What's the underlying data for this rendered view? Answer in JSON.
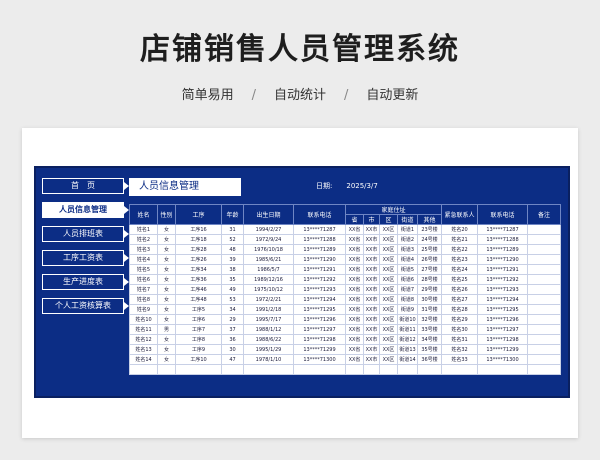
{
  "page": {
    "title": "店铺销售人员管理系统",
    "features": [
      "简单易用",
      "自动统计",
      "自动更新"
    ],
    "separator": "/"
  },
  "sidebar": {
    "items": [
      {
        "label": "首　页",
        "active": false
      },
      {
        "label": "人员信息管理",
        "active": true
      },
      {
        "label": "人员排班表",
        "active": false
      },
      {
        "label": "工序工资表",
        "active": false
      },
      {
        "label": "生产进度表",
        "active": false
      },
      {
        "label": "个人工资核算表",
        "active": false
      }
    ]
  },
  "header": {
    "section_title": "人员信息管理",
    "date_label": "日期:",
    "date_value": "2025/3/7"
  },
  "table": {
    "headers": {
      "name": "姓名",
      "gender": "性别",
      "process": "工序",
      "age": "年龄",
      "birth": "出生日期",
      "phone": "联系电话",
      "address": "家庭住址",
      "province": "省",
      "city": "市",
      "district": "区",
      "street": "街道",
      "other": "其他",
      "emergency_contact": "紧急联系人",
      "emergency_phone": "联系电话",
      "remark": "备注"
    },
    "rows": [
      {
        "name": "姓名1",
        "gender": "女",
        "process": "工序16",
        "age": "31",
        "birth": "1994/2/27",
        "phone": "13****71287",
        "province": "XX省",
        "city": "XX市",
        "district": "XX区",
        "street": "街道1",
        "other": "23号楼",
        "ec": "姓名20",
        "ep": "13****71287",
        "remark": ""
      },
      {
        "name": "姓名2",
        "gender": "女",
        "process": "工序18",
        "age": "52",
        "birth": "1972/9/24",
        "phone": "13****71288",
        "province": "XX省",
        "city": "XX市",
        "district": "XX区",
        "street": "街道2",
        "other": "24号楼",
        "ec": "姓名21",
        "ep": "13****71288",
        "remark": ""
      },
      {
        "name": "姓名3",
        "gender": "女",
        "process": "工序28",
        "age": "48",
        "birth": "1976/10/18",
        "phone": "13****71289",
        "province": "XX省",
        "city": "XX市",
        "district": "XX区",
        "street": "街道3",
        "other": "25号楼",
        "ec": "姓名22",
        "ep": "13****71289",
        "remark": ""
      },
      {
        "name": "姓名4",
        "gender": "女",
        "process": "工序26",
        "age": "39",
        "birth": "1985/6/21",
        "phone": "13****71290",
        "province": "XX省",
        "city": "XX市",
        "district": "XX区",
        "street": "街道4",
        "other": "26号楼",
        "ec": "姓名23",
        "ep": "13****71290",
        "remark": ""
      },
      {
        "name": "姓名5",
        "gender": "女",
        "process": "工序34",
        "age": "38",
        "birth": "1986/5/7",
        "phone": "13****71291",
        "province": "XX省",
        "city": "XX市",
        "district": "XX区",
        "street": "街道5",
        "other": "27号楼",
        "ec": "姓名24",
        "ep": "13****71291",
        "remark": ""
      },
      {
        "name": "姓名6",
        "gender": "女",
        "process": "工序36",
        "age": "35",
        "birth": "1989/12/16",
        "phone": "13****71292",
        "province": "XX省",
        "city": "XX市",
        "district": "XX区",
        "street": "街道6",
        "other": "28号楼",
        "ec": "姓名25",
        "ep": "13****71292",
        "remark": ""
      },
      {
        "name": "姓名7",
        "gender": "女",
        "process": "工序46",
        "age": "49",
        "birth": "1975/10/12",
        "phone": "13****71293",
        "province": "XX省",
        "city": "XX市",
        "district": "XX区",
        "street": "街道7",
        "other": "29号楼",
        "ec": "姓名26",
        "ep": "13****71293",
        "remark": ""
      },
      {
        "name": "姓名8",
        "gender": "女",
        "process": "工序48",
        "age": "53",
        "birth": "1972/2/21",
        "phone": "13****71294",
        "province": "XX省",
        "city": "XX市",
        "district": "XX区",
        "street": "街道8",
        "other": "30号楼",
        "ec": "姓名27",
        "ep": "13****71294",
        "remark": ""
      },
      {
        "name": "姓名9",
        "gender": "女",
        "process": "工序5",
        "age": "34",
        "birth": "1991/2/18",
        "phone": "13****71295",
        "province": "XX省",
        "city": "XX市",
        "district": "XX区",
        "street": "街道9",
        "other": "31号楼",
        "ec": "姓名28",
        "ep": "13****71295",
        "remark": ""
      },
      {
        "name": "姓名10",
        "gender": "女",
        "process": "工序6",
        "age": "29",
        "birth": "1995/7/17",
        "phone": "13****71296",
        "province": "XX省",
        "city": "XX市",
        "district": "XX区",
        "street": "街道10",
        "other": "32号楼",
        "ec": "姓名29",
        "ep": "13****71296",
        "remark": ""
      },
      {
        "name": "姓名11",
        "gender": "男",
        "process": "工序7",
        "age": "37",
        "birth": "1988/1/12",
        "phone": "13****71297",
        "province": "XX省",
        "city": "XX市",
        "district": "XX区",
        "street": "街道11",
        "other": "33号楼",
        "ec": "姓名30",
        "ep": "13****71297",
        "remark": ""
      },
      {
        "name": "姓名12",
        "gender": "女",
        "process": "工序8",
        "age": "36",
        "birth": "1988/6/22",
        "phone": "13****71298",
        "province": "XX省",
        "city": "XX市",
        "district": "XX区",
        "street": "街道12",
        "other": "34号楼",
        "ec": "姓名31",
        "ep": "13****71298",
        "remark": ""
      },
      {
        "name": "姓名13",
        "gender": "女",
        "process": "工序9",
        "age": "30",
        "birth": "1995/1/29",
        "phone": "13****71299",
        "province": "XX省",
        "city": "XX市",
        "district": "XX区",
        "street": "街道13",
        "other": "35号楼",
        "ec": "姓名32",
        "ep": "13****71299",
        "remark": ""
      },
      {
        "name": "姓名14",
        "gender": "女",
        "process": "工序10",
        "age": "47",
        "birth": "1978/1/10",
        "phone": "13****71300",
        "province": "XX省",
        "city": "XX市",
        "district": "XX区",
        "street": "街道14",
        "other": "36号楼",
        "ec": "姓名33",
        "ep": "13****71300",
        "remark": ""
      }
    ]
  }
}
